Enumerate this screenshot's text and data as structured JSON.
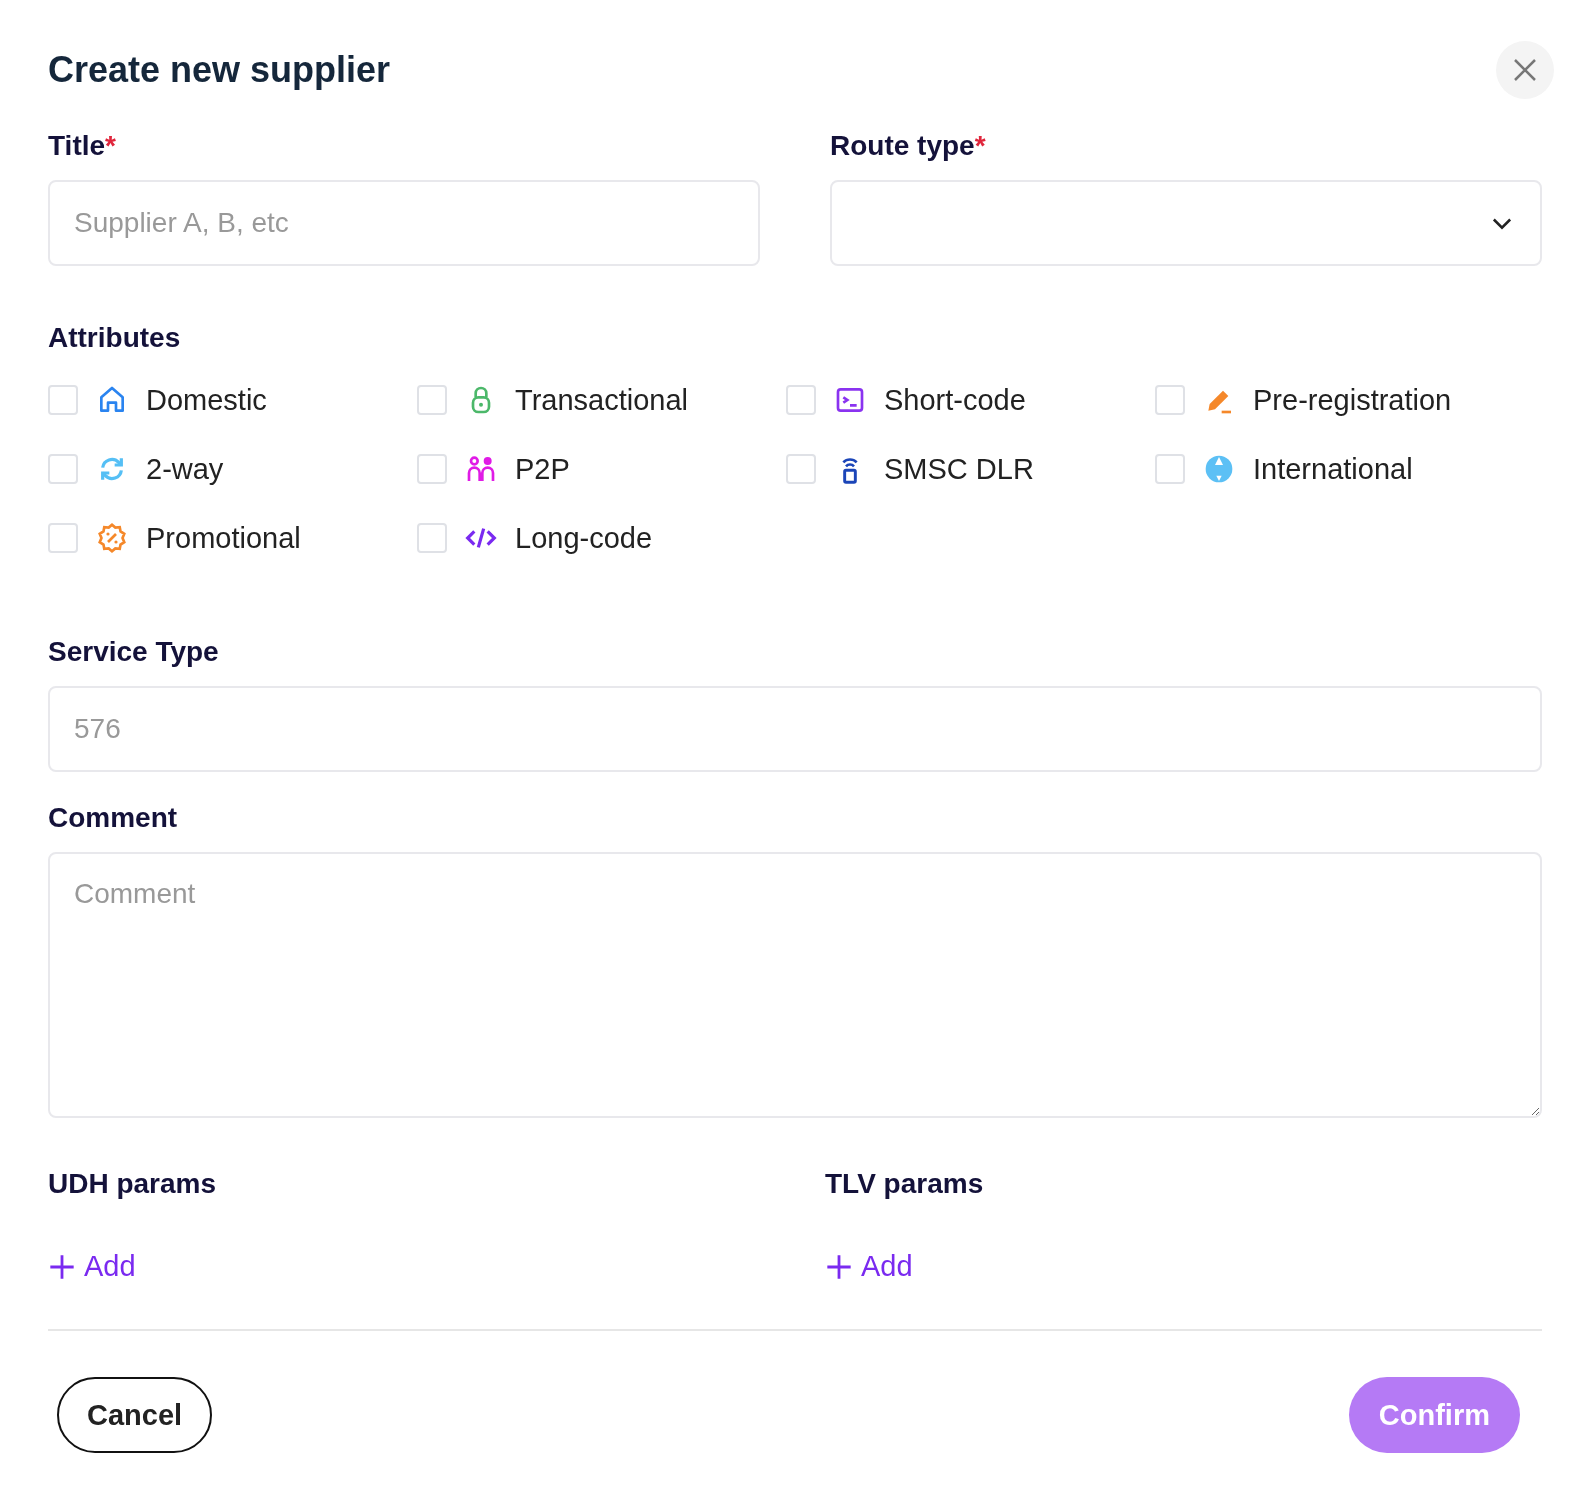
{
  "dialog": {
    "title": "Create new supplier"
  },
  "title_field": {
    "label": "Title",
    "required_mark": "*",
    "placeholder": "Supplier A, B, etc"
  },
  "route_type": {
    "label": "Route type",
    "required_mark": "*"
  },
  "attributes": {
    "label": "Attributes",
    "items": [
      {
        "label": "Domestic",
        "kind": "house",
        "checked": false
      },
      {
        "label": "Transactional",
        "kind": "lock",
        "checked": false
      },
      {
        "label": "Short-code",
        "kind": "terminal",
        "checked": false
      },
      {
        "label": "Pre-registration",
        "kind": "pencil",
        "checked": false
      },
      {
        "label": "2-way",
        "kind": "sync",
        "checked": false
      },
      {
        "label": "P2P",
        "kind": "people",
        "checked": false
      },
      {
        "label": "SMSC DLR",
        "kind": "signal",
        "checked": false
      },
      {
        "label": "International",
        "kind": "globe",
        "checked": false
      },
      {
        "label": "Promotional",
        "kind": "discount",
        "checked": false
      },
      {
        "label": "Long-code",
        "kind": "code",
        "checked": false
      }
    ]
  },
  "service_type": {
    "label": "Service Type",
    "placeholder": "576"
  },
  "comment": {
    "label": "Comment",
    "placeholder": "Comment"
  },
  "udh_params": {
    "label": "UDH params",
    "add_button": "Add"
  },
  "tlv_params": {
    "label": "TLV params",
    "add_button": "Add"
  },
  "buttons": {
    "cancel": "Cancel",
    "confirm": "Confirm"
  }
}
